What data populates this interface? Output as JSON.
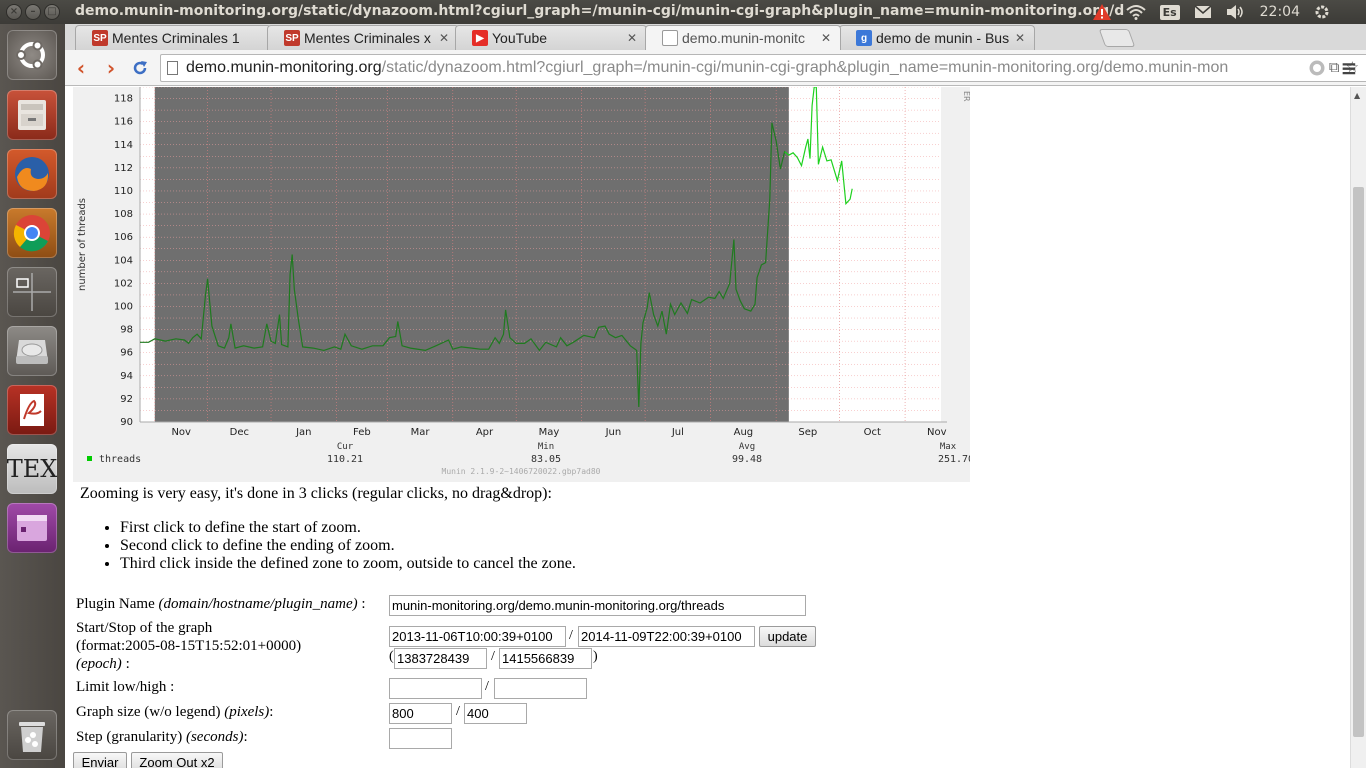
{
  "os": {
    "window_title": "demo.munin-monitoring.org/static/dynazoom.html?cgiurl_graph=/munin-cgi/munin-cgi-graph&plugin_name=munin-monitoring.org/demo.munin-monitoring.org/threads",
    "keyboard_layout": "Es",
    "clock": "22:04",
    "launcher_items": [
      {
        "name": "dash-home",
        "icon": "ubuntu-logo-icon"
      },
      {
        "name": "files",
        "icon": "file-cabinet-icon"
      },
      {
        "name": "firefox",
        "icon": "firefox-icon"
      },
      {
        "name": "chrome",
        "icon": "chrome-icon"
      },
      {
        "name": "workspace-switcher",
        "icon": "workspaces-icon"
      },
      {
        "name": "disk",
        "icon": "hard-disk-icon"
      },
      {
        "name": "pdf-viewer",
        "icon": "pdf-reader-icon"
      },
      {
        "name": "tex-editor",
        "icon": "tex-icon",
        "text": "TEX"
      },
      {
        "name": "app",
        "icon": "purple-window-icon"
      },
      {
        "name": "trash",
        "icon": "trash-icon"
      }
    ]
  },
  "browser": {
    "tabs": [
      {
        "label": "Mentes Criminales 1",
        "favicon_text": "SP",
        "favicon_color": "#c0392b"
      },
      {
        "label": "Mentes Criminales x",
        "favicon_text": "SP",
        "favicon_color": "#c0392b"
      },
      {
        "label": "YouTube",
        "favicon_text": "▶",
        "favicon_color": "#e52d27"
      },
      {
        "label": "demo.munin-monitc",
        "favicon_text": "",
        "favicon_color": "#ffffff",
        "active": true
      },
      {
        "label": "demo de munin - Bus",
        "favicon_text": "g",
        "favicon_color": "#3c78d8"
      }
    ],
    "url_host": "demo.munin-monitoring.org",
    "url_path": "/static/dynazoom.html?cgiurl_graph=/munin-cgi/munin-cgi-graph&plugin_name=munin-monitoring.org/demo.munin-mon"
  },
  "graph": {
    "ylabel": "number of threads",
    "side_text": "ER",
    "legend": {
      "headers": [
        "Cur",
        "Min",
        "Avg",
        "Max"
      ],
      "series": "threads",
      "series_color": "#00cc00",
      "values": [
        "110.21",
        "83.05",
        "99.48",
        "251.70"
      ],
      "footer": "Munin 2.1.9-2~1406720022.gbp7ad80"
    }
  },
  "chart_data": {
    "type": "line",
    "ylabel": "number of threads",
    "ylim": [
      90,
      119
    ],
    "y_ticks": [
      90,
      92,
      94,
      96,
      98,
      100,
      102,
      104,
      106,
      108,
      110,
      112,
      114,
      116,
      118
    ],
    "x_ticks": [
      "Nov",
      "Dec",
      "Jan",
      "Feb",
      "Mar",
      "Apr",
      "May",
      "Jun",
      "Jul",
      "Aug",
      "Sep",
      "Oct",
      "Nov"
    ],
    "x_ticks_days": [
      0,
      25,
      55,
      86,
      110,
      141,
      171,
      202,
      232,
      263,
      294,
      324,
      355
    ],
    "xlim_days": [
      -7,
      372
    ],
    "highlight_days": [
      0,
      300
    ],
    "grid": true,
    "series": [
      {
        "name": "threads",
        "points": [
          [
            -7,
            96.9
          ],
          [
            -3,
            96.9
          ],
          [
            0,
            97.2
          ],
          [
            5,
            97
          ],
          [
            10,
            97.2
          ],
          [
            14,
            97.1
          ],
          [
            16,
            96.8
          ],
          [
            18,
            97.3
          ],
          [
            20,
            97.6
          ],
          [
            22,
            97.2
          ],
          [
            24,
            101
          ],
          [
            25,
            102.4
          ],
          [
            27,
            98.3
          ],
          [
            30,
            96.6
          ],
          [
            33,
            96.4
          ],
          [
            35,
            97.3
          ],
          [
            36,
            98.5
          ],
          [
            38,
            96.4
          ],
          [
            42,
            96.6
          ],
          [
            47,
            96.4
          ],
          [
            51,
            96.5
          ],
          [
            53,
            98.5
          ],
          [
            55,
            97
          ],
          [
            57,
            96.8
          ],
          [
            59,
            99.3
          ],
          [
            60,
            96.7
          ],
          [
            63,
            96.5
          ],
          [
            64,
            102.8
          ],
          [
            65,
            104.5
          ],
          [
            66,
            101.5
          ],
          [
            68,
            98.8
          ],
          [
            70,
            96.5
          ],
          [
            75,
            96.4
          ],
          [
            80,
            96.2
          ],
          [
            85,
            96.5
          ],
          [
            88,
            96.3
          ],
          [
            90,
            97.6
          ],
          [
            93,
            96.6
          ],
          [
            98,
            96.3
          ],
          [
            103,
            96.6
          ],
          [
            108,
            96.6
          ],
          [
            111,
            97.3
          ],
          [
            114,
            97.4
          ],
          [
            115,
            98.7
          ],
          [
            117,
            96.6
          ],
          [
            121,
            96.4
          ],
          [
            128,
            96.2
          ],
          [
            133,
            96.6
          ],
          [
            139,
            97.1
          ],
          [
            141,
            96.3
          ],
          [
            145,
            96.5
          ],
          [
            150,
            96.4
          ],
          [
            154,
            96.3
          ],
          [
            158,
            96.3
          ],
          [
            161,
            97.3
          ],
          [
            163,
            96.8
          ],
          [
            165,
            97.6
          ],
          [
            166,
            99.7
          ],
          [
            168,
            97.3
          ],
          [
            171,
            96.8
          ],
          [
            175,
            96.8
          ],
          [
            178,
            97.2
          ],
          [
            182,
            96.2
          ],
          [
            185,
            96.9
          ],
          [
            190,
            96.5
          ],
          [
            192,
            97.3
          ],
          [
            195,
            96.6
          ],
          [
            198,
            96.9
          ],
          [
            203,
            97.5
          ],
          [
            208,
            97.3
          ],
          [
            210,
            98.2
          ],
          [
            213,
            98.3
          ],
          [
            215,
            97.6
          ],
          [
            218,
            97.3
          ],
          [
            221,
            97.5
          ],
          [
            225,
            96.6
          ],
          [
            228,
            96.2
          ],
          [
            229,
            91.3
          ],
          [
            230,
            96.8
          ],
          [
            231,
            98.6
          ],
          [
            233,
            99.9
          ],
          [
            234,
            101.2
          ],
          [
            236,
            99.3
          ],
          [
            238,
            98.3
          ],
          [
            240,
            99.6
          ],
          [
            242,
            97.6
          ],
          [
            244,
            100.2
          ],
          [
            246,
            99.3
          ],
          [
            249,
            100.3
          ],
          [
            252,
            99.4
          ],
          [
            254,
            100.6
          ],
          [
            258,
            100.3
          ],
          [
            262,
            100.8
          ],
          [
            265,
            100.7
          ],
          [
            267,
            101.3
          ],
          [
            269,
            100.7
          ],
          [
            272,
            102
          ],
          [
            274,
            105.8
          ],
          [
            275,
            101.5
          ],
          [
            277,
            100.5
          ],
          [
            279,
            99.8
          ],
          [
            282,
            99.6
          ],
          [
            284,
            100.2
          ],
          [
            285,
            102.5
          ],
          [
            287,
            103.6
          ],
          [
            289,
            103.8
          ],
          [
            291,
            109.3
          ],
          [
            292,
            115.9
          ],
          [
            294,
            114.3
          ],
          [
            296,
            111.9
          ],
          [
            298,
            113.4
          ],
          [
            300,
            113.1
          ],
          [
            302,
            113.3
          ],
          [
            304,
            112.9
          ],
          [
            306,
            112.2
          ],
          [
            308,
            113.8
          ],
          [
            309,
            114.5
          ],
          [
            310,
            112.8
          ],
          [
            311,
            117.4
          ],
          [
            312,
            119
          ],
          [
            313,
            119
          ],
          [
            314,
            112.3
          ],
          [
            316,
            113.8
          ],
          [
            318,
            112.6
          ],
          [
            320,
            112.7
          ],
          [
            323,
            110.9
          ],
          [
            325,
            112.6
          ],
          [
            327,
            108.9
          ],
          [
            329,
            109.3
          ],
          [
            330,
            110.2
          ]
        ]
      }
    ]
  },
  "page": {
    "intro": "Zooming is very easy, it's done in 3 clicks (regular clicks, no drag&drop):",
    "steps": [
      "First click to define the start of zoom.",
      "Second click to define the ending of zoom.",
      "Third click inside the defined zone to zoom, outside to cancel the zone."
    ]
  },
  "form": {
    "plugin_label": "Plugin Name",
    "plugin_hint": "(domain/hostname/plugin_name)",
    "plugin_value": "munin-monitoring.org/demo.munin-monitoring.org/threads",
    "startstop_label": "Start/Stop of the graph",
    "startstop_format": "(format:2005-08-15T15:52:01+0000)",
    "epoch_hint": "(epoch)",
    "start_iso": "2013-11-06T10:00:39+0100",
    "stop_iso": "2014-11-09T22:00:39+0100",
    "update_label": "update",
    "start_epoch": "1383728439",
    "stop_epoch": "1415566839",
    "limit_label": "Limit low/high :",
    "limit_low": "",
    "limit_high": "",
    "size_label": "Graph size (w/o legend)",
    "size_hint": "(pixels)",
    "size_w": "800",
    "size_h": "400",
    "step_label": "Step (granularity)",
    "step_hint": "(seconds)",
    "step_value": "",
    "submit_label": "Enviar",
    "zoomout_label": "Zoom Out x2"
  }
}
